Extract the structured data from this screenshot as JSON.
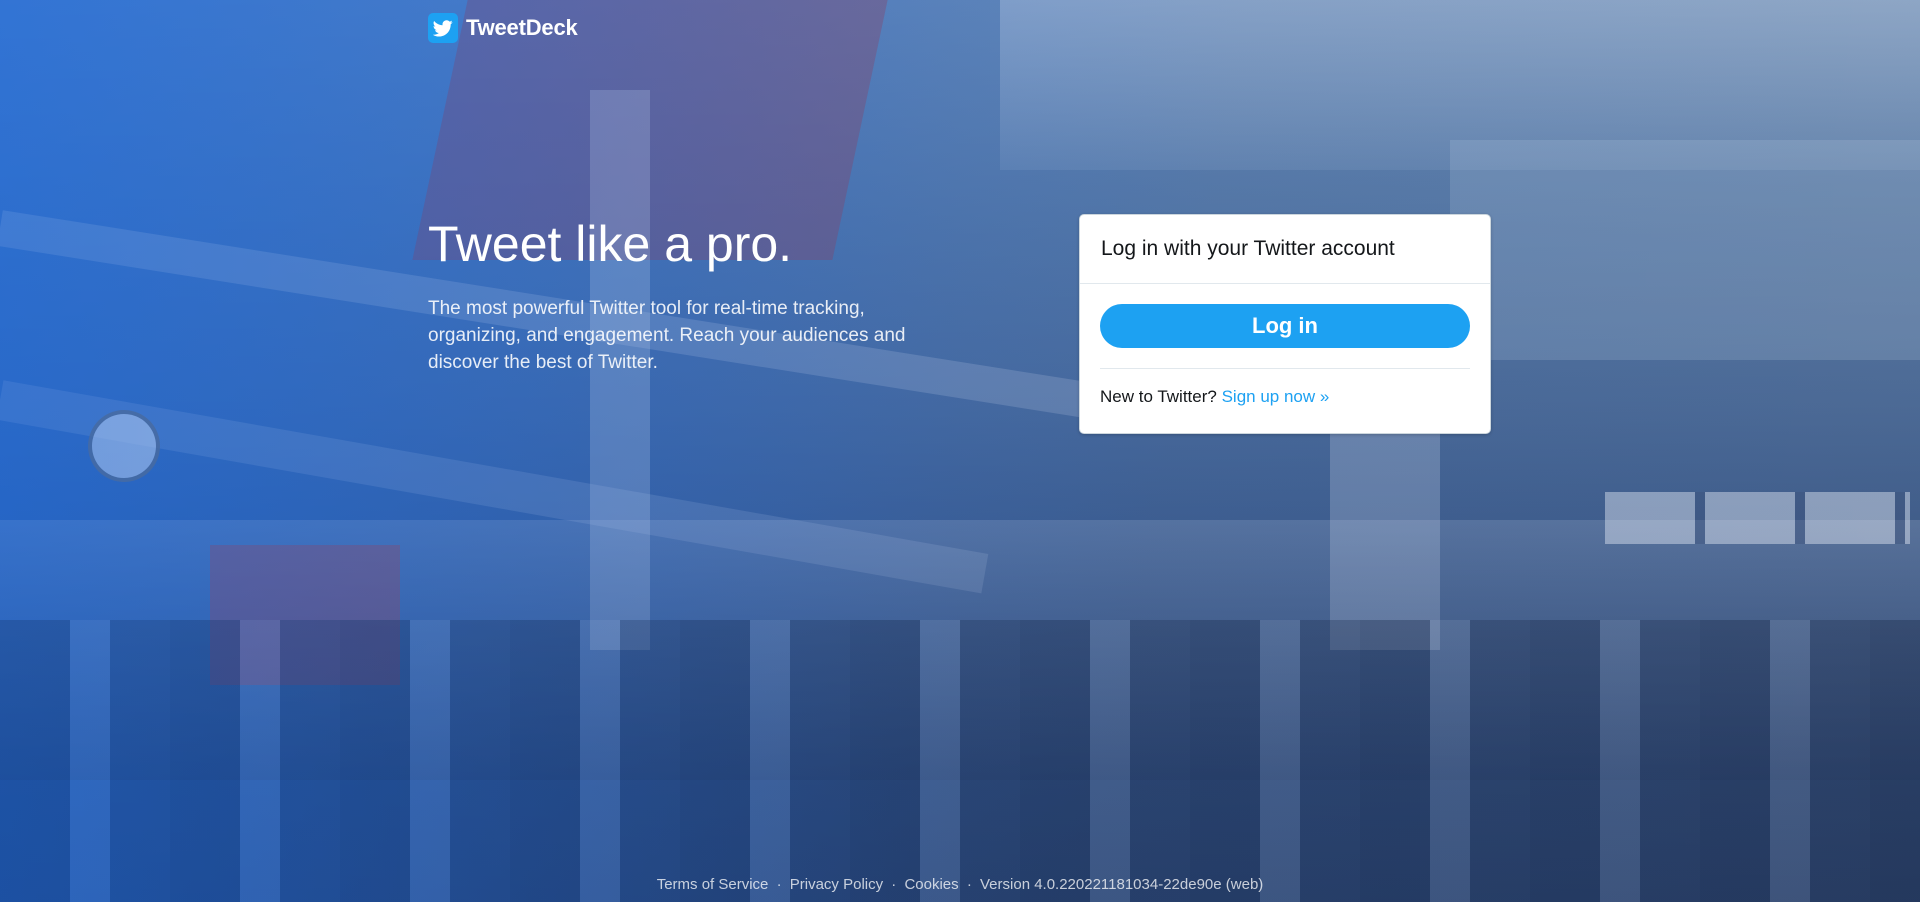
{
  "brand": {
    "name": "TweetDeck",
    "icon": "twitter-bird-icon",
    "accent": "#1da1f2"
  },
  "hero": {
    "title": "Tweet like a pro.",
    "subtitle": "The most powerful Twitter tool for real-time tracking, organizing, and engagement. Reach your audiences and discover the best of Twitter."
  },
  "login_card": {
    "heading": "Log in with your Twitter account",
    "login_button": "Log in",
    "new_prompt": "New to Twitter?",
    "signup_link": "Sign up now »"
  },
  "footer": {
    "terms": "Terms of Service",
    "privacy": "Privacy Policy",
    "cookies": "Cookies",
    "version": "Version 4.0.220221181034-22de90e (web)",
    "separator": "·"
  }
}
